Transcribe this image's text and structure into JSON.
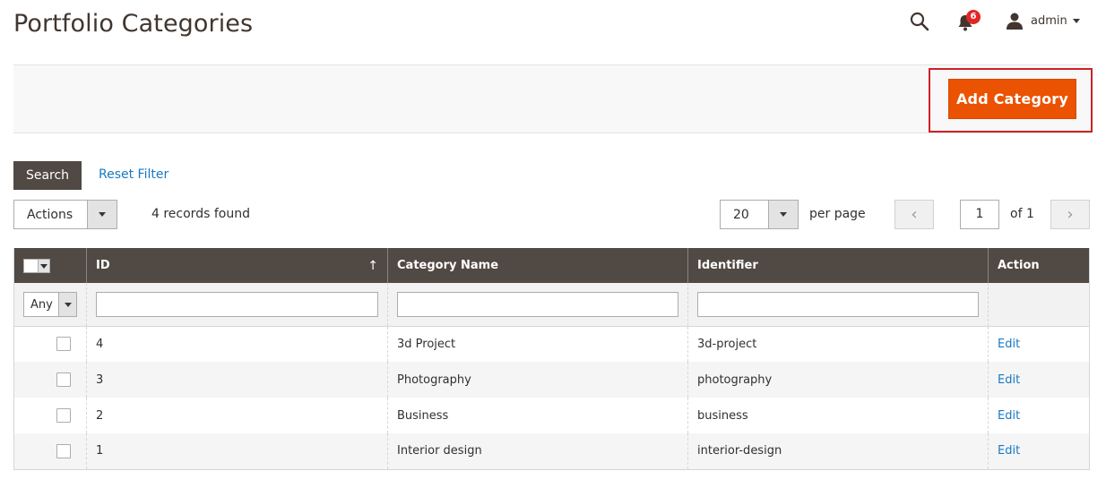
{
  "page": {
    "title": "Portfolio Categories"
  },
  "header": {
    "notifications_count": "6",
    "user_name": "admin"
  },
  "toolbar": {
    "add_label": "Add Category"
  },
  "filters": {
    "search_label": "Search",
    "reset_label": "Reset Filter"
  },
  "grid_controls": {
    "actions_label": "Actions",
    "records_found": "4 records found",
    "per_page_value": "20",
    "per_page_label": "per page",
    "prev_symbol": "‹",
    "next_symbol": "›",
    "current_page": "1",
    "page_of": "of 1"
  },
  "table": {
    "columns": [
      "ID",
      "Category Name",
      "Identifier",
      "Action"
    ],
    "sort_indicator": "↑",
    "filter_any": "Any",
    "rows": [
      {
        "id": "4",
        "name": "3d Project",
        "identifier": "3d-project",
        "action": "Edit"
      },
      {
        "id": "3",
        "name": "Photography",
        "identifier": "photography",
        "action": "Edit"
      },
      {
        "id": "2",
        "name": "Business",
        "identifier": "business",
        "action": "Edit"
      },
      {
        "id": "1",
        "name": "Interior design",
        "identifier": "interior-design",
        "action": "Edit"
      }
    ]
  },
  "colors": {
    "accent": "#eb5202",
    "header_bg": "#514943",
    "link": "#1979c3",
    "badge": "#e22626",
    "highlight": "#d02128"
  },
  "icons": [
    "search-icon",
    "bell-icon",
    "user-icon",
    "caret-down-icon"
  ]
}
